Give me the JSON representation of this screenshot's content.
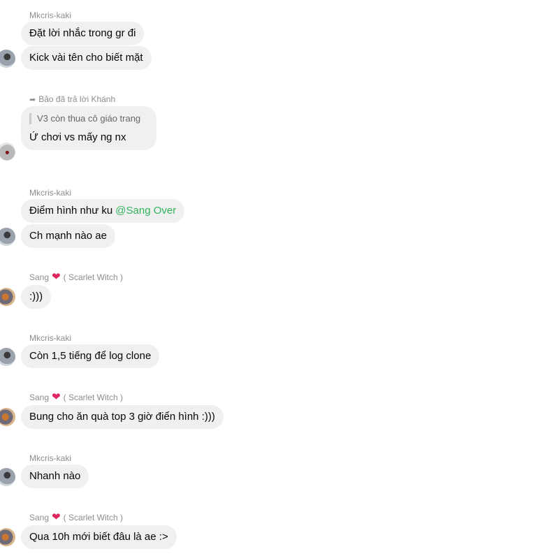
{
  "messages": [
    {
      "sender": "Mkcris-kaki",
      "lines": [
        "Đặt lời nhắc trong gr đi",
        "Kick vài tên cho biết mặt"
      ]
    },
    {
      "reply_header": "Bảo đã trả lời Khánh",
      "quote": "V3 còn thua cô giáo trang",
      "text": "Ứ chơi vs mấy ng nx"
    },
    {
      "sender": "Mkcris-kaki",
      "lines": [
        "Điểm hình như ku",
        "Ch mạnh nào ae"
      ],
      "mention": "@Sang Over"
    },
    {
      "sender_name": "Sang",
      "sender_suffix": "( Scarlet Witch )",
      "lines": [
        ":)))"
      ]
    },
    {
      "sender": "Mkcris-kaki",
      "lines": [
        "Còn 1,5 tiếng để log clone"
      ]
    },
    {
      "sender_name": "Sang",
      "sender_suffix": "( Scarlet Witch )",
      "lines": [
        "Bung cho ăn quà top 3 giờ điển hình :)))"
      ]
    },
    {
      "sender": "Mkcris-kaki",
      "lines": [
        "Nhanh nào"
      ]
    },
    {
      "sender_name": "Sang",
      "sender_suffix": "( Scarlet Witch )",
      "lines": [
        "Qua 10h mới biết đâu là ae :>"
      ]
    }
  ],
  "colors": {
    "bubble": "#f0f0f0",
    "mention": "#31b35e",
    "heart": "#e0245e",
    "meta": "#8a8d91"
  },
  "icons": {
    "reply": "reply-arrow-icon",
    "heart": "heart-icon"
  }
}
